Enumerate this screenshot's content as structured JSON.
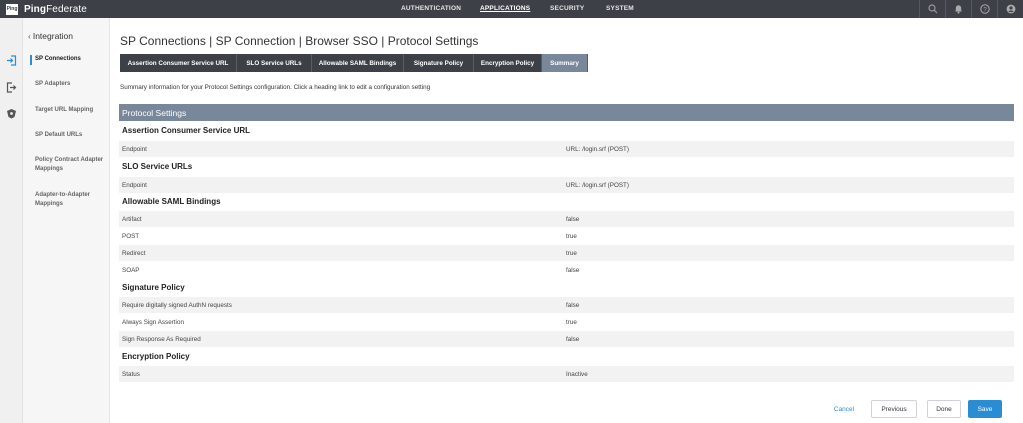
{
  "app": {
    "logo_mark": "Ping",
    "name_bold": "Ping",
    "name_rest": "Federate"
  },
  "topnav": [
    "AUTHENTICATION",
    "APPLICATIONS",
    "SECURITY",
    "SYSTEM"
  ],
  "topnav_active": "APPLICATIONS",
  "top_icons": [
    "search-icon",
    "bell-icon",
    "help-icon",
    "user-icon"
  ],
  "rail_icons": [
    "sign-in-icon",
    "sign-out-icon",
    "shield-icon"
  ],
  "sidebar": {
    "back_label": "Integration",
    "items": [
      {
        "label": "SP Connections",
        "active": true
      },
      {
        "label": "SP Adapters",
        "active": false
      },
      {
        "label": "Target URL Mapping",
        "active": false
      },
      {
        "label": "SP Default URLs",
        "active": false
      },
      {
        "label": "Policy Contract Adapter Mappings",
        "active": false
      },
      {
        "label": "Adapter-to-Adapter Mappings",
        "active": false
      }
    ]
  },
  "page_title": "SP Connections | SP Connection | Browser SSO | Protocol Settings",
  "tabs": [
    {
      "label": "Assertion Consumer Service URL"
    },
    {
      "label": "SLO Service URLs"
    },
    {
      "label": "Allowable SAML Bindings"
    },
    {
      "label": "Signature Policy"
    },
    {
      "label": "Encryption Policy"
    },
    {
      "label": "Summary",
      "active": true
    }
  ],
  "intro": "Summary information for your Protocol Settings configuration. Click a heading link to edit a configuration setting",
  "section_title": "Protocol Settings",
  "groups": {
    "acs": {
      "title": "Assertion Consumer Service URL",
      "rows": [
        {
          "key": "Endpoint",
          "value": "URL: /login.srf (POST)"
        }
      ]
    },
    "slo": {
      "title": "SLO Service URLs",
      "rows": [
        {
          "key": "Endpoint",
          "value": "URL: /login.srf (POST)"
        }
      ]
    },
    "bindings": {
      "title": "Allowable SAML Bindings",
      "rows": [
        {
          "key": "Artifact",
          "value": "false"
        },
        {
          "key": "POST",
          "value": "true"
        },
        {
          "key": "Redirect",
          "value": "true"
        },
        {
          "key": "SOAP",
          "value": "false"
        }
      ]
    },
    "signature": {
      "title": "Signature Policy",
      "rows": [
        {
          "key": "Require digitally signed AuthN requests",
          "value": "false"
        },
        {
          "key": "Always Sign Assertion",
          "value": "true"
        },
        {
          "key": "Sign Response As Required",
          "value": "false"
        }
      ]
    },
    "encryption": {
      "title": "Encryption Policy",
      "rows": [
        {
          "key": "Status",
          "value": "Inactive"
        }
      ]
    }
  },
  "buttons": {
    "cancel": "Cancel",
    "previous": "Previous",
    "done": "Done",
    "save": "Save"
  },
  "colors": {
    "topbar": "#3d4046",
    "tab_active": "#79879a",
    "accent": "#2a8dd4"
  }
}
